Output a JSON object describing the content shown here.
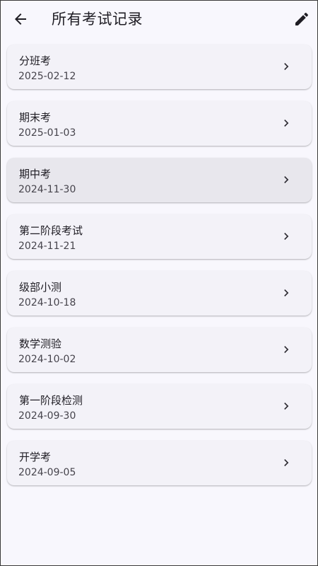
{
  "appbar": {
    "title": "所有考试记录",
    "back_icon": "arrow-left-icon",
    "edit_icon": "pencil-icon"
  },
  "colors": {
    "background": "#f8f7fd",
    "card": "#f3f2f8",
    "card_highlight": "#e8e7ed",
    "text_primary": "#1f1d24",
    "text_secondary": "#46444c"
  },
  "exams": [
    {
      "name": "分班考",
      "date": "2025-02-12",
      "highlighted": false
    },
    {
      "name": "期末考",
      "date": "2025-01-03",
      "highlighted": false
    },
    {
      "name": "期中考",
      "date": "2024-11-30",
      "highlighted": true
    },
    {
      "name": "第二阶段考试",
      "date": "2024-11-21",
      "highlighted": false
    },
    {
      "name": "级部小测",
      "date": "2024-10-18",
      "highlighted": false
    },
    {
      "name": "数学测验",
      "date": "2024-10-02",
      "highlighted": false
    },
    {
      "name": "第一阶段检测",
      "date": "2024-09-30",
      "highlighted": false
    },
    {
      "name": "开学考",
      "date": "2024-09-05",
      "highlighted": false
    }
  ]
}
